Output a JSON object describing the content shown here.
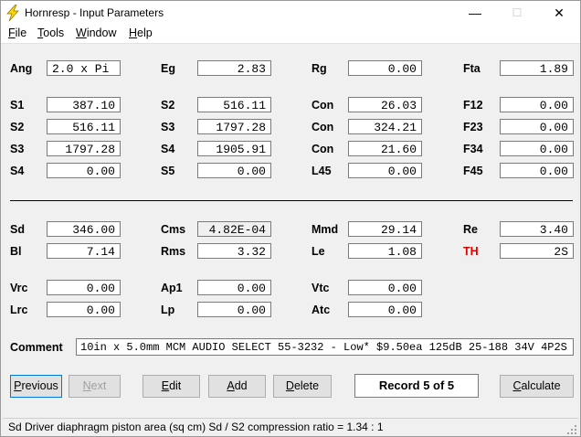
{
  "window": {
    "title": "Hornresp - Input Parameters",
    "minimize": "—",
    "maximize": "☐",
    "close": "✕",
    "app_icon": "lightning-bolt-icon"
  },
  "menu": [
    {
      "label": "File",
      "key": "F",
      "rest": "ile"
    },
    {
      "label": "Tools",
      "key": "T",
      "rest": "ools"
    },
    {
      "label": "Window",
      "key": "W",
      "rest": "indow"
    },
    {
      "label": "Help",
      "key": "H",
      "rest": "elp"
    }
  ],
  "params": {
    "Ang": {
      "label": "Ang",
      "value": "2.0 x Pi"
    },
    "Eg": {
      "label": "Eg",
      "value": "2.83"
    },
    "Rg": {
      "label": "Rg",
      "value": "0.00"
    },
    "Fta": {
      "label": "Fta",
      "value": "1.89"
    },
    "S1": {
      "label": "S1",
      "value": "387.10"
    },
    "S2a": {
      "label": "S2",
      "value": "516.11"
    },
    "Con1": {
      "label": "Con",
      "value": "26.03"
    },
    "F12": {
      "label": "F12",
      "value": "0.00"
    },
    "S2": {
      "label": "S2",
      "value": "516.11"
    },
    "S3a": {
      "label": "S3",
      "value": "1797.28"
    },
    "Con2": {
      "label": "Con",
      "value": "324.21"
    },
    "F23": {
      "label": "F23",
      "value": "0.00"
    },
    "S3": {
      "label": "S3",
      "value": "1797.28"
    },
    "S4a": {
      "label": "S4",
      "value": "1905.91"
    },
    "Con3": {
      "label": "Con",
      "value": "21.60"
    },
    "F34": {
      "label": "F34",
      "value": "0.00"
    },
    "S4": {
      "label": "S4",
      "value": "0.00"
    },
    "S5": {
      "label": "S5",
      "value": "0.00"
    },
    "L45": {
      "label": "L45",
      "value": "0.00"
    },
    "F45": {
      "label": "F45",
      "value": "0.00"
    },
    "Sd": {
      "label": "Sd",
      "value": "346.00"
    },
    "Cms": {
      "label": "Cms",
      "value": "4.82E-04"
    },
    "Mmd": {
      "label": "Mmd",
      "value": "29.14"
    },
    "Re": {
      "label": "Re",
      "value": "3.40"
    },
    "Bl": {
      "label": "Bl",
      "value": "7.14"
    },
    "Rms": {
      "label": "Rms",
      "value": "3.32"
    },
    "Le": {
      "label": "Le",
      "value": "1.08"
    },
    "TH": {
      "label": "TH",
      "value": "2S"
    },
    "Vrc": {
      "label": "Vrc",
      "value": "0.00"
    },
    "Ap1": {
      "label": "Ap1",
      "value": "0.00"
    },
    "Vtc": {
      "label": "Vtc",
      "value": "0.00"
    },
    "Lrc": {
      "label": "Lrc",
      "value": "0.00"
    },
    "Lp": {
      "label": "Lp",
      "value": "0.00"
    },
    "Atc": {
      "label": "Atc",
      "value": "0.00"
    }
  },
  "comment": {
    "label": "Comment",
    "value": "10in x 5.0mm MCM AUDIO SELECT 55-3232 - Low* $9.50ea 125dB 25-188 34V 4P2S"
  },
  "buttons": {
    "previous": {
      "key": "P",
      "rest": "revious"
    },
    "next": {
      "key": "N",
      "rest": "ext"
    },
    "edit": {
      "key": "E",
      "rest": "dit"
    },
    "add": {
      "key": "A",
      "rest": "dd"
    },
    "delete": {
      "key": "D",
      "rest": "elete"
    },
    "calculate": {
      "key": "C",
      "rest": "alculate"
    }
  },
  "record": "Record 5 of 5",
  "status": "Sd   Driver diaphragm piston area  (sq cm)   Sd / S2 compression ratio = 1.34 : 1",
  "colors": {
    "accent_label": "#e00000",
    "focus_border": "#0078d7",
    "icon_bolt": "#ffd800"
  }
}
